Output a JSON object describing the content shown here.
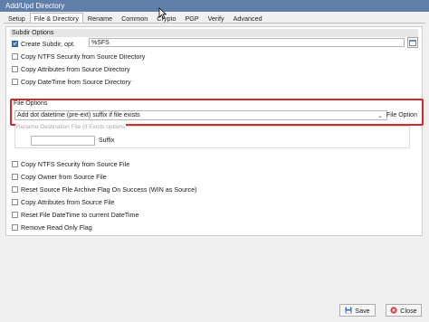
{
  "window": {
    "title": "Add/Upd Directory"
  },
  "tabs": [
    {
      "label": "Setup",
      "active": false
    },
    {
      "label": "File & Directory",
      "active": true
    },
    {
      "label": "Rename",
      "active": false
    },
    {
      "label": "Common",
      "active": false
    },
    {
      "label": "Crypto",
      "active": false
    },
    {
      "label": "PGP",
      "active": false
    },
    {
      "label": "Verify",
      "active": false
    },
    {
      "label": "Advanced",
      "active": false
    }
  ],
  "subdir_options": {
    "header": "Subdir Options",
    "create_subdir": {
      "label": "Create Subdir, opt.",
      "checked": true,
      "value": "%SFS"
    },
    "copy_ntfs_security": {
      "label": "Copy NTFS Security from Source Directory",
      "checked": false
    },
    "copy_attributes": {
      "label": "Copy Attributes from Source Directory",
      "checked": false
    },
    "copy_datetime": {
      "label": "Copy DateTime from Source Directory",
      "checked": false
    }
  },
  "file_options": {
    "header": "File Options",
    "exists_mode": {
      "selected": "Add dot datetime (pre-ext) suffix if file exists",
      "side_label": "File Option"
    },
    "rename_frame": {
      "label": "Rename Destination File (if Exists options",
      "suffix_value": "",
      "suffix_label": "Suffix"
    },
    "items": [
      {
        "label": "Copy NTFS Security from Source File",
        "checked": false
      },
      {
        "label": "Copy Owner from Source File",
        "checked": false
      },
      {
        "label": "Reset Source File Archive Flag On Success (WIN as Source)",
        "checked": false
      },
      {
        "label": "Copy Attributes from Source File",
        "checked": false
      },
      {
        "label": "Reset File DateTime to current DateTime",
        "checked": false
      },
      {
        "label": "Remove Read Only Flag",
        "checked": false
      }
    ]
  },
  "footer": {
    "save_label": "Save",
    "close_label": "Close"
  },
  "colors": {
    "titlebar": "#5f7ea8",
    "highlight": "#d22b2b",
    "accent": "#3b78c4"
  }
}
